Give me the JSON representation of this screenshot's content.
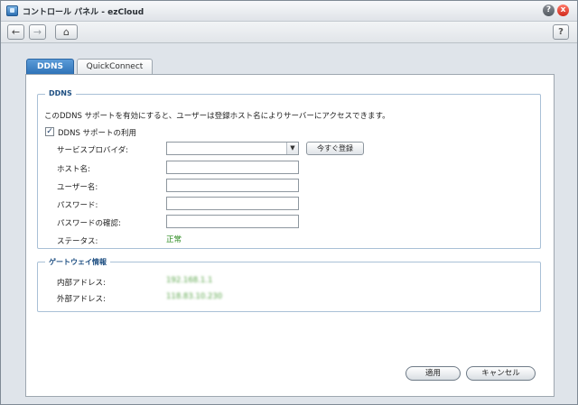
{
  "window": {
    "title": "コントロール パネル - ezCloud",
    "help_glyph": "?",
    "close_glyph": "x"
  },
  "toolbar": {
    "back_glyph": "←",
    "forward_glyph": "→",
    "home_glyph": "⌂",
    "help_glyph": "?"
  },
  "tabs": [
    {
      "label": "DDNS",
      "active": true
    },
    {
      "label": "QuickConnect",
      "active": false
    }
  ],
  "ddns_section": {
    "legend": "DDNS",
    "description": "このDDNS サポートを有効にすると、ユーザーは登録ホスト名によりサーバーにアクセスできます。",
    "enable_checkbox": {
      "label": "DDNS サポートの利用",
      "checked": true,
      "mark": "✓"
    },
    "fields": [
      {
        "label": "サービスプロバイダ:",
        "value": ""
      },
      {
        "label": "ホスト名:",
        "value": ""
      },
      {
        "label": "ユーザー名:",
        "value": ""
      },
      {
        "label": "パスワード:",
        "value": ""
      },
      {
        "label": "パスワードの確認:",
        "value": ""
      }
    ],
    "select_arrow": "▼",
    "register_button": "今すぐ登録",
    "status_label": "ステータス:",
    "status_value": "正常",
    "status_color": "#2a8a1e"
  },
  "gateway_section": {
    "legend": "ゲートウェイ情報",
    "internal_label": "内部アドレス:",
    "internal_value": "192.168.1.1",
    "external_label": "外部アドレス:",
    "external_value": "118.83.10.230"
  },
  "buttons": {
    "apply": "適用",
    "cancel": "キャンセル"
  },
  "colors": {
    "active_tab": "#2f73b8",
    "legend": "#1e4f82"
  }
}
